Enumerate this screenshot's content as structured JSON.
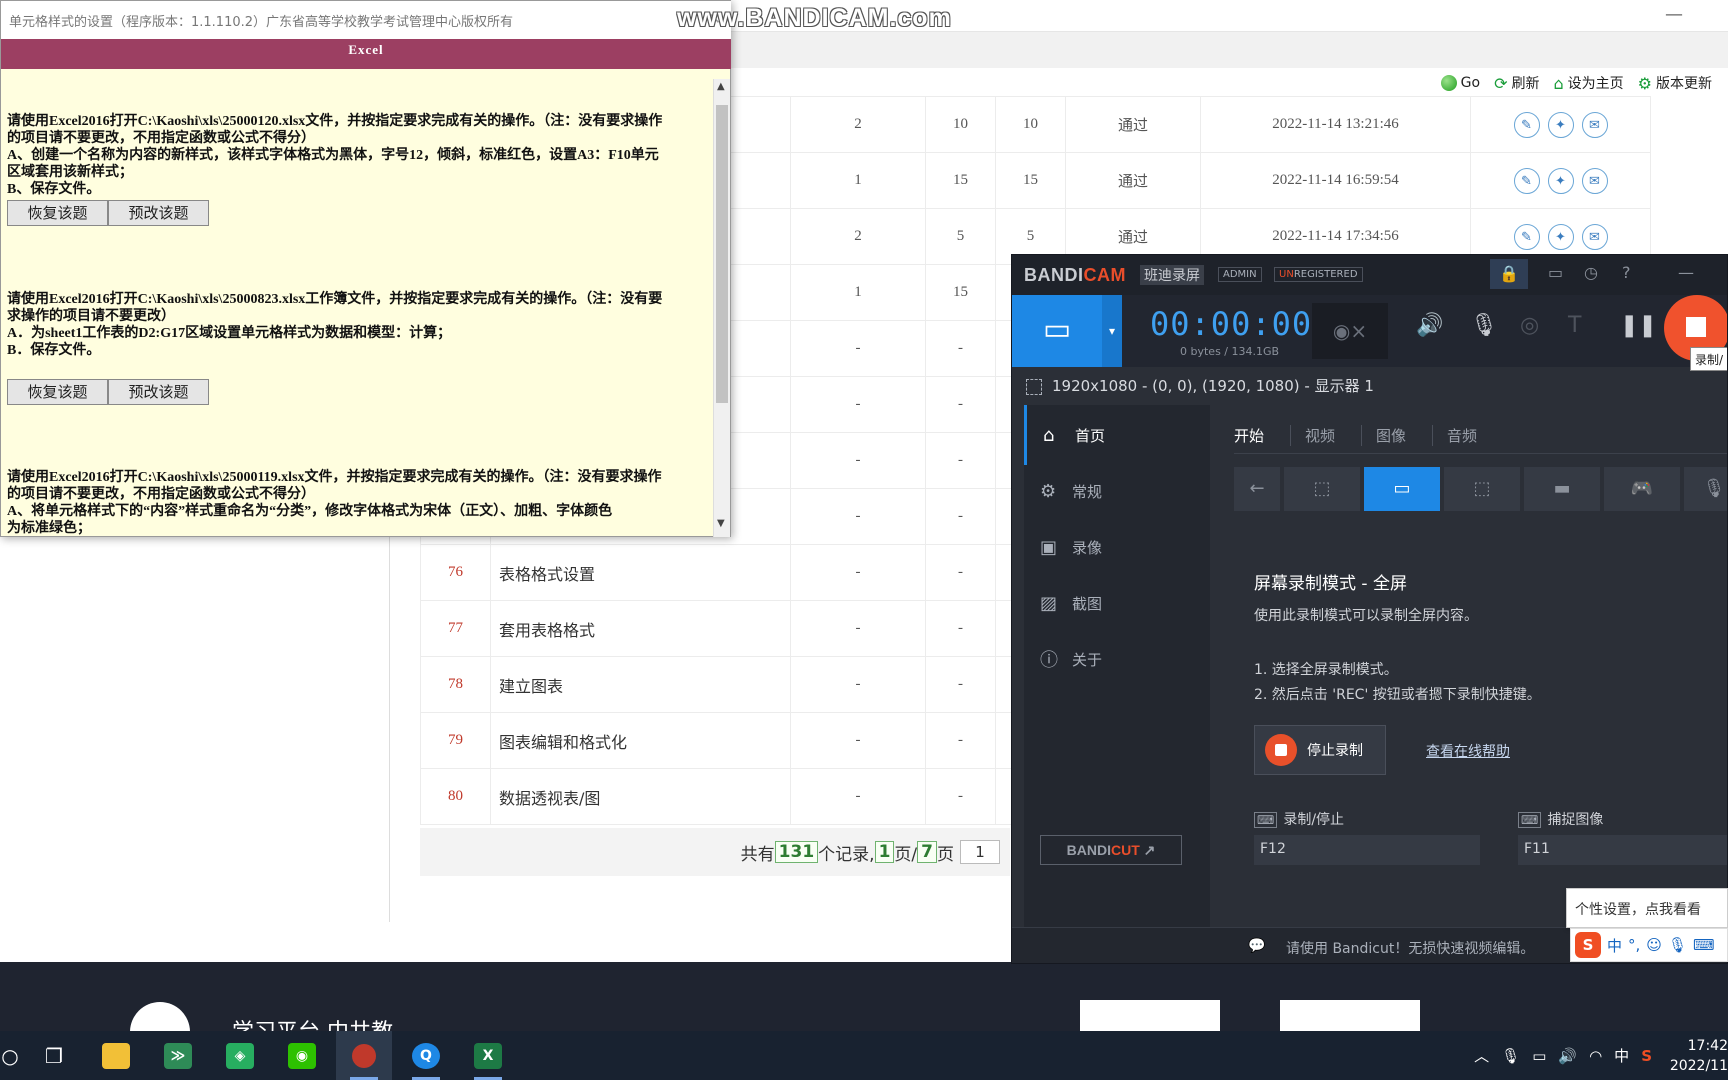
{
  "watermark": "www.BANDICAM.com",
  "background": {
    "minimize": "—",
    "toolbar": [
      {
        "icon": "green-dot-icon",
        "label": "Go"
      },
      {
        "icon": "refresh-icon",
        "label": "刷新"
      },
      {
        "icon": "home-icon",
        "label": "设为主页"
      },
      {
        "icon": "gear-icon",
        "label": "版本更新"
      }
    ],
    "table_rows": [
      {
        "num": "",
        "title": "",
        "a": "2",
        "b": "10",
        "c": "10",
        "status": "通过",
        "time": "2022-11-14 13:21:46",
        "actions": true
      },
      {
        "num": "",
        "title": "",
        "a": "1",
        "b": "15",
        "c": "15",
        "status": "通过",
        "time": "2022-11-14 16:59:54",
        "actions": true
      },
      {
        "num": "",
        "title": "",
        "a": "2",
        "b": "5",
        "c": "5",
        "status": "通过",
        "time": "2022-11-14 17:34:56",
        "actions": true
      },
      {
        "num": "",
        "title": "",
        "a": "1",
        "b": "15",
        "c": "",
        "status": "",
        "time": "",
        "actions": false
      },
      {
        "num": "",
        "title": "",
        "a": "-",
        "b": "-",
        "c": "",
        "status": "",
        "time": "",
        "actions": false
      },
      {
        "num": "",
        "title": "",
        "a": "-",
        "b": "-",
        "c": "",
        "status": "",
        "time": "",
        "actions": false
      },
      {
        "num": "",
        "title": "",
        "a": "-",
        "b": "-",
        "c": "",
        "status": "",
        "time": "",
        "actions": false
      },
      {
        "num": "",
        "title": "",
        "a": "-",
        "b": "-",
        "c": "",
        "status": "",
        "time": "",
        "actions": false
      },
      {
        "num": "76",
        "title": "表格格式设置",
        "a": "-",
        "b": "-",
        "c": "",
        "status": "",
        "time": "",
        "actions": false
      },
      {
        "num": "77",
        "title": "套用表格格式",
        "a": "-",
        "b": "-",
        "c": "",
        "status": "",
        "time": "",
        "actions": false
      },
      {
        "num": "78",
        "title": "建立图表",
        "a": "-",
        "b": "-",
        "c": "",
        "status": "",
        "time": "",
        "actions": false
      },
      {
        "num": "79",
        "title": "图表编辑和格式化",
        "a": "-",
        "b": "-",
        "c": "",
        "status": "",
        "time": "",
        "actions": false
      },
      {
        "num": "80",
        "title": "数据透视表/图",
        "a": "-",
        "b": "-",
        "c": "",
        "status": "",
        "time": "",
        "actions": false
      }
    ],
    "pager": {
      "prefix": "共有",
      "total": "131",
      "records": "个记录,",
      "page": "1",
      "slash": "页/",
      "pages": "7",
      "suffix": "页",
      "input": "1"
    },
    "footer_text": "学习平台  中共教"
  },
  "dialog": {
    "title": "单元格样式的设置（程序版本：1.1.110.2）广东省高等学校教学考试管理中心版权所有",
    "close": "✕",
    "band": "Excel",
    "questions": [
      {
        "lines": [
          "请使用Excel2016打开C:\\Kaoshi\\xls\\25000120.xlsx文件，并按指定要求完成有关的操作。（注：没有要求操作",
          "的项目请不要更改，不用指定函数或公式不得分）",
          "A、创建一个名称为内容的新样式，该样式字体格式为黑体，字号12，倾斜，标准红色，设置A3：F10单元",
          "区域套用该新样式；",
          "B、保存文件。"
        ],
        "restore": "恢复该题",
        "revise": "预改该题"
      },
      {
        "lines": [
          "请使用Excel2016打开C:\\Kaoshi\\xls\\25000823.xlsx工作簿文件，并按指定要求完成有关的操作。（注：没有要",
          "求操作的项目请不要更改）",
          "A．为sheet1工作表的D2:G17区域设置单元格样式为数据和模型：计算；",
          "B．保存文件。"
        ],
        "restore": "恢复该题",
        "revise": "预改该题"
      },
      {
        "lines": [
          "请使用Excel2016打开C:\\Kaoshi\\xls\\25000119.xlsx文件，并按指定要求完成有关的操作。（注：没有要求操作",
          "的项目请不要更改，不用指定函数或公式不得分）",
          "A、将单元格样式下的“内容”样式重命名为“分类”，修改字体格式为宋体（正文）、加粗、字体颜色",
          "为标准绿色；"
        ]
      }
    ]
  },
  "bandicam": {
    "logo_a": "BANDI",
    "logo_b": "CAM",
    "cn_name": "班迪录屏",
    "tag_admin": "ADMIN",
    "tag_un": "UN",
    "tag_registered": "REGISTERED",
    "timer": "00:00:00",
    "size": "0 bytes / 134.1GB",
    "rec_tip": "录制/",
    "target": "1920x1080 - (0, 0), (1920, 1080) - 显示器 1",
    "nav": [
      "首页",
      "常规",
      "录像",
      "截图",
      "关于"
    ],
    "tabs": [
      "开始",
      "视频",
      "图像",
      "音频"
    ],
    "mode_title": "屏幕录制模式 - 全屏",
    "mode_desc": "使用此录制模式可以录制全屏内容。",
    "step1": "1. 选择全屏录制模式。",
    "step2": "2. 然后点击 'REC' 按钮或者摁下录制快捷键。",
    "stop_label": "停止录制",
    "help_link": "查看在线帮助",
    "hotkey1_label": "录制/停止",
    "hotkey1_value": "F12",
    "hotkey2_label": "捕捉图像",
    "hotkey2_value": "F11",
    "bandicut_a": "BANDI",
    "bandicut_b": "CUT",
    "status": "请使用 Bandicut！无损快速视频编辑。"
  },
  "tooltip": "个性设置，点我看看",
  "ime": {
    "lang": "中",
    "punct": "°,"
  },
  "taskbar": {
    "tray_lang": "中",
    "time": "17:42",
    "date": "2022/11"
  }
}
